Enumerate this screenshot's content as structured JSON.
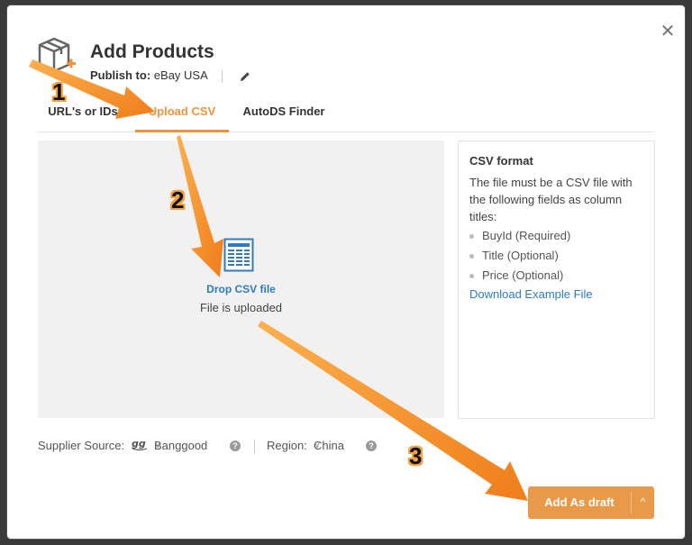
{
  "dialog": {
    "title": "Add Products",
    "publish_label": "Publish to:",
    "publish_value": "eBay USA",
    "close_glyph": "✕"
  },
  "tabs": [
    {
      "label": "URL's or IDs",
      "active": false
    },
    {
      "label": "Upload CSV",
      "active": true
    },
    {
      "label": "AutoDS Finder",
      "active": false
    }
  ],
  "dropzone": {
    "icon": "csv-file-icon",
    "label": "Drop CSV file",
    "status": "File is uploaded"
  },
  "csv_format": {
    "heading": "CSV format",
    "description": "The file must be a CSV file with the following fields as column titles:",
    "fields": [
      "BuyId (Required)",
      "Title (Optional)",
      "Price (Optional)"
    ],
    "download_link": "Download Example File"
  },
  "footer": {
    "supplier_label": "Supplier Source:",
    "supplier_value": "Banggood",
    "region_label": "Region:",
    "region_value": "China",
    "help_glyph": "?"
  },
  "action": {
    "primary_label": "Add As draft",
    "caret_glyph": "^"
  },
  "annotations": {
    "steps": [
      "1",
      "2",
      "3"
    ],
    "arrow_color": "#f5952a"
  },
  "colors": {
    "accent": "#f0943b",
    "link": "#2e7bc4",
    "button": "#e89a4a"
  }
}
